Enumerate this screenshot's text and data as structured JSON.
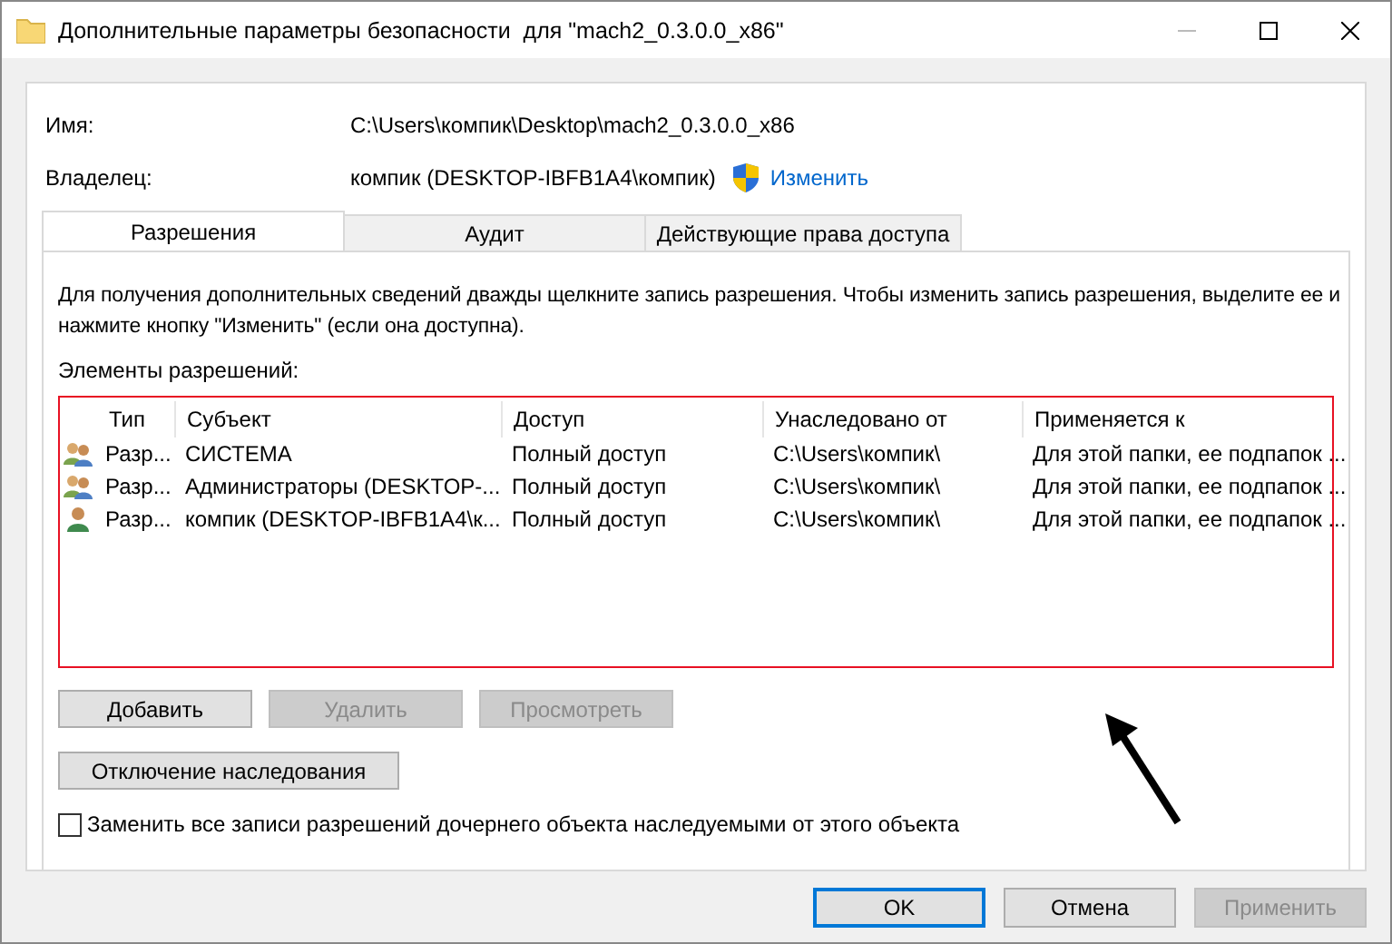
{
  "window": {
    "title": "Дополнительные параметры безопасности  для \"mach2_0.3.0.0_x86\""
  },
  "name": {
    "label": "Имя:",
    "value": "C:\\Users\\компик\\Desktop\\mach2_0.3.0.0_x86"
  },
  "owner": {
    "label": "Владелец:",
    "value": "компик (DESKTOP-IBFB1A4\\компик)",
    "change_link": "Изменить"
  },
  "tabs": [
    {
      "label": "Разрешения",
      "selected": true
    },
    {
      "label": "Аудит",
      "selected": false
    },
    {
      "label": "Действующие права доступа",
      "selected": false
    }
  ],
  "instructions": "Для получения дополнительных сведений дважды щелкните запись разрешения. Чтобы изменить запись разрешения, выделите ее и нажмите кнопку \"Изменить\" (если она доступна).",
  "list_label": "Элементы разрешений:",
  "table": {
    "columns": [
      "Тип",
      "Субъект",
      "Доступ",
      "Унаследовано от",
      "Применяется к"
    ],
    "rows": [
      {
        "kind": "group",
        "cells": [
          "Разр...",
          "СИСТЕМА",
          "Полный доступ",
          "C:\\Users\\компик\\",
          "Для этой папки, ее подпапок ..."
        ]
      },
      {
        "kind": "group",
        "cells": [
          "Разр...",
          "Администраторы (DESKTOP-...",
          "Полный доступ",
          "C:\\Users\\компик\\",
          "Для этой папки, ее подпапок ..."
        ]
      },
      {
        "kind": "user",
        "cells": [
          "Разр...",
          "компик (DESKTOP-IBFB1A4\\к...",
          "Полный доступ",
          "C:\\Users\\компик\\",
          "Для этой папки, ее подпапок ..."
        ]
      }
    ]
  },
  "entry_buttons": [
    {
      "label": "Добавить",
      "disabled": false
    },
    {
      "label": "Удалить",
      "disabled": true
    },
    {
      "label": "Просмотреть",
      "disabled": true
    }
  ],
  "inheritance_button": "Отключение наследования",
  "replace_checkbox": {
    "label": "Заменить все записи разрешений дочернего объекта наследуемыми от этого объекта",
    "checked": false
  },
  "dialog_buttons": [
    {
      "label": "OK",
      "disabled": false,
      "default": true
    },
    {
      "label": "Отмена",
      "disabled": false,
      "default": false
    },
    {
      "label": "Применить",
      "disabled": true,
      "default": false
    }
  ]
}
